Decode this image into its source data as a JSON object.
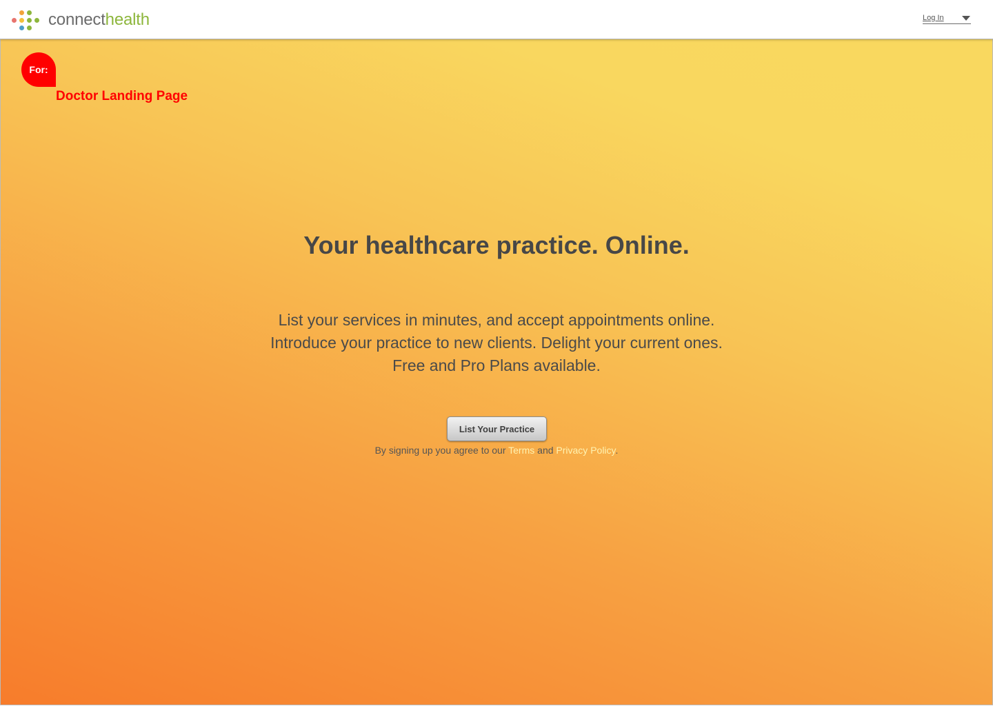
{
  "header": {
    "brand": {
      "part1": "connect",
      "part2": "health"
    },
    "login_label": "Log In"
  },
  "hero": {
    "tag": "For:",
    "page_label": "Doctor Landing Page",
    "headline": "Your healthcare practice. Online.",
    "intro_lines": [
      "List your services in minutes, and accept appointments online.",
      "Introduce your practice to new clients. Delight your current ones.",
      "Free and Pro Plans available."
    ],
    "cta_label": "List Your Practice",
    "legal": {
      "prefix": "By signing up you agree to our",
      "terms": "Terms",
      "and": "and",
      "privacy": "Privacy Policy",
      "suffix": "."
    }
  },
  "icons": {
    "logo": "dot-grid-logo-icon",
    "login_menu": "caret-down-icon"
  },
  "colors": {
    "brand_green": "#8db63c",
    "brand_gray": "#6b6b6b",
    "tag_red": "#ff0000",
    "gradient_top": "#f9d85f",
    "gradient_bottom": "#f77c2b",
    "link_color": "#fff2b0"
  }
}
